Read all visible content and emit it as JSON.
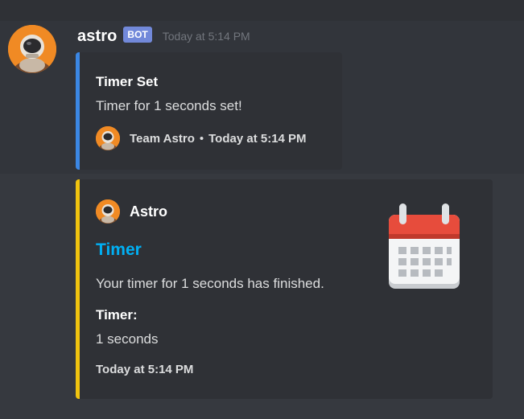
{
  "message": {
    "author": "astro",
    "bot_badge": "BOT",
    "timestamp": "Today at 5:14 PM",
    "avatar_icon": "astronaut-avatar-icon"
  },
  "embed1": {
    "accent_color": "#3b87e4",
    "title": "Timer Set",
    "description": "Timer for 1 seconds set!",
    "footer": {
      "icon": "astronaut-avatar-icon",
      "text": "Team Astro",
      "separator": "•",
      "timestamp": "Today at 5:14 PM"
    }
  },
  "embed2": {
    "accent_color": "#f1c40f",
    "author": {
      "icon": "astronaut-avatar-icon",
      "name": "Astro"
    },
    "title": "Timer",
    "title_color": "#00b0f4",
    "description": "Your timer for 1 seconds has finished.",
    "field": {
      "name": "Timer:",
      "value": "1 seconds"
    },
    "footer_timestamp": "Today at 5:14 PM",
    "thumbnail_icon": "calendar-icon"
  }
}
